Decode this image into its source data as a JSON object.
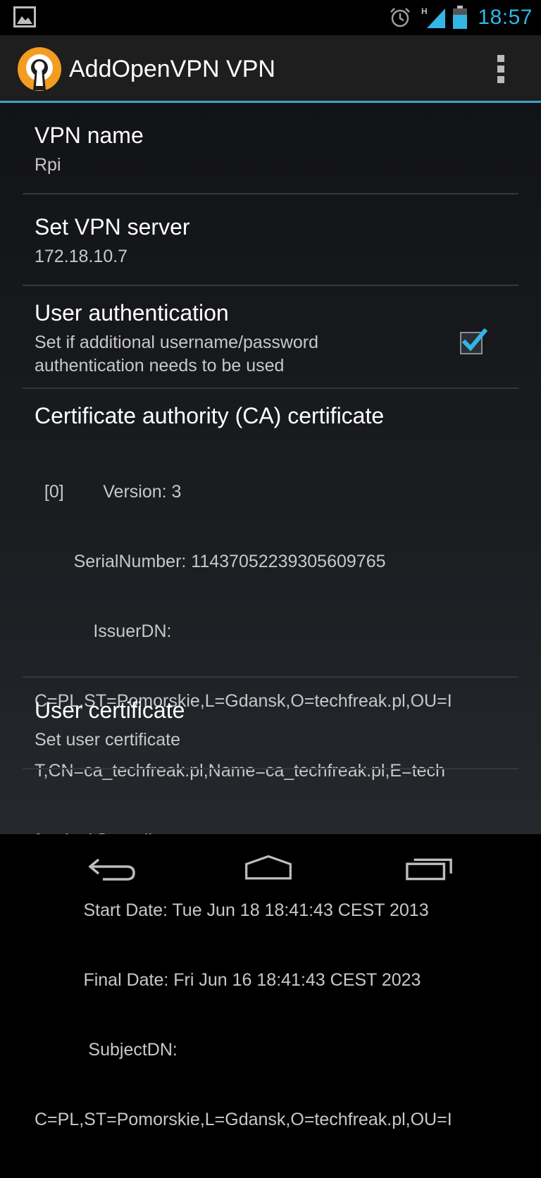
{
  "status_bar": {
    "time": "18:57",
    "network_type": "H",
    "icons": [
      "gallery-notification-icon",
      "alarm-icon",
      "signal-icon",
      "battery-icon"
    ]
  },
  "action_bar": {
    "title": "AddOpenVPN VPN",
    "icons": [
      "openvpn-app-icon",
      "overflow-menu-icon"
    ]
  },
  "preferences": [
    {
      "title": "VPN name",
      "summary": "Rpi"
    },
    {
      "title": "Set VPN server",
      "summary": "172.18.10.7"
    },
    {
      "title": "User authentication",
      "summary_lines": [
        "Set if additional username/password",
        "authentication needs to be used"
      ],
      "checked": true
    },
    {
      "title": "Certificate authority (CA) certificate",
      "lines": [
        "  [0]        Version: 3",
        "        SerialNumber: 11437052239305609765",
        "            IssuerDN:",
        "C=PL,ST=Pomorskie,L=Gdansk,O=techfreak.pl,OU=I",
        "T,CN=ca_techfreak.pl,Name=ca_techfreak.pl,E=tech",
        "freak.pl@gmail.com",
        "          Start Date: Tue Jun 18 18:41:43 CEST 2013",
        "          Final Date: Fri Jun 16 18:41:43 CEST 2023",
        "           SubjectDN:",
        "C=PL,ST=Pomorskie,L=Gdansk,O=techfreak.pl,OU=I"
      ]
    },
    {
      "title": "User certificate",
      "summary": "Set user certificate"
    }
  ],
  "nav_bar": {
    "icons": [
      "back-icon",
      "home-icon",
      "recent-apps-icon"
    ]
  },
  "colors": {
    "accent": "#33b5e5",
    "action_bar_divider": "#3aa1d5",
    "app_icon_orange": "#f39c1f"
  }
}
